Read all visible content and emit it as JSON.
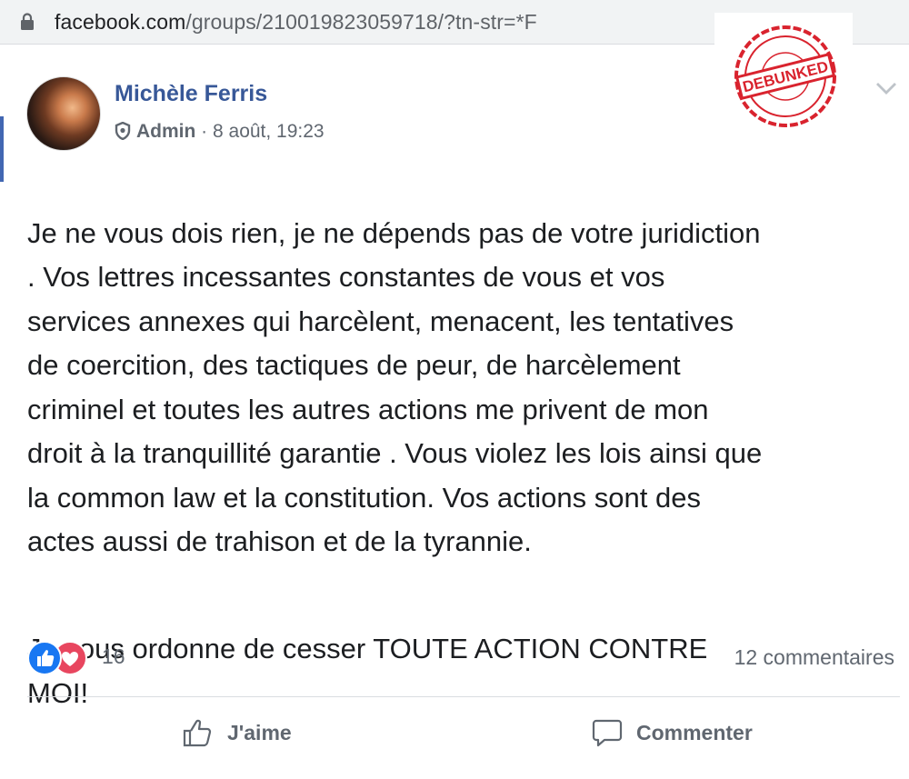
{
  "browser": {
    "url_domain": "facebook.com",
    "url_rest": "/groups/210019823059718/?tn-str=*F"
  },
  "stamp": {
    "text": "DEBUNKED",
    "color": "#d9232e"
  },
  "post": {
    "author": "Michèle Ferris",
    "role": "Admin",
    "separator": " · ",
    "date": "8 août, 19:23",
    "paragraphs": [
      "Je ne vous dois rien, je ne dépends pas de votre juridiction\n. Vos lettres incessantes constantes de  vous et vos\nservices annexes qui harcèlent, menacent, les  tentatives\nde coercition, des tactiques de peur, de harcèlement\ncriminel  et toutes les autres actions me privent de mon\ndroit à la  tranquillité garantie . Vous violez les lois ainsi que\nla common law et  la constitution. Vos actions sont des\nactes aussi de trahison et de la  tyrannie.",
      "Je vous ordonne de cesser  TOUTE ACTION CONTRE\nMOI!"
    ]
  },
  "reactions": {
    "count": "16",
    "icons": [
      "like-reaction-icon",
      "love-reaction-icon"
    ],
    "like_color": "#1877f2",
    "love_color": "#e8465f"
  },
  "comments_label": "12 commentaires",
  "actions": {
    "like_label": "J'aime",
    "comment_label": "Commenter"
  },
  "colors": {
    "author": "#385898",
    "text": "#1c1e21",
    "muted": "#606770"
  }
}
